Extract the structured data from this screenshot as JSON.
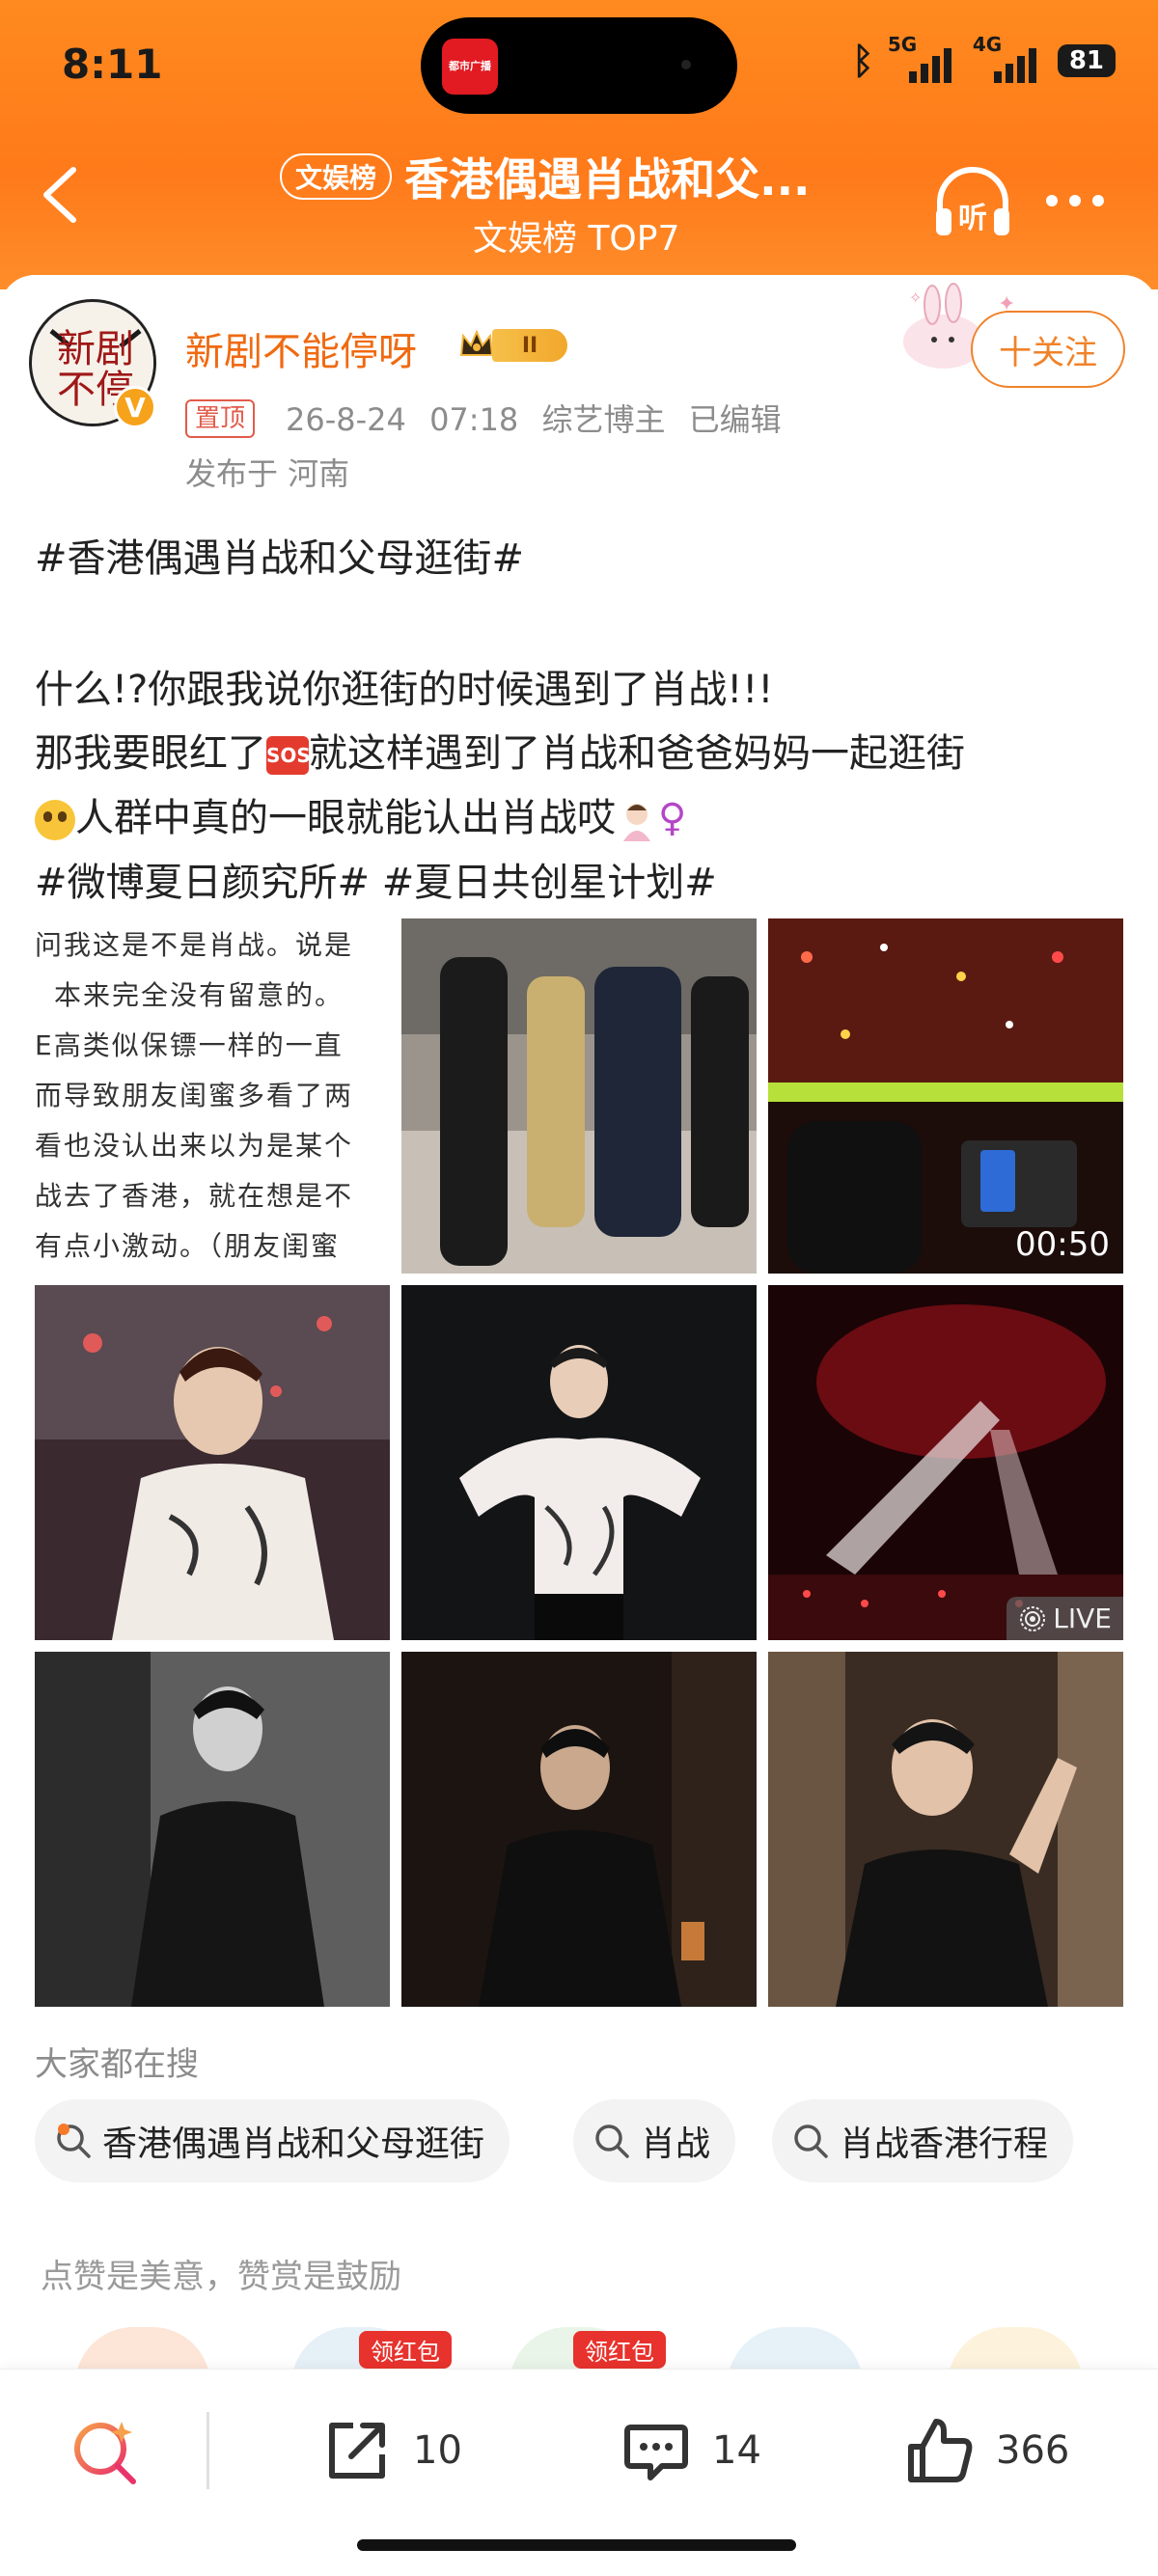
{
  "status_bar": {
    "time": "8:11",
    "island_app_label": "都市广播",
    "net_5g": "5G",
    "net_4g": "4G",
    "battery": "81"
  },
  "nav": {
    "tag": "文娱榜",
    "title": "香港偶遇肖战和父...",
    "subtitle": "文娱榜 TOP7",
    "headphone_label": "听"
  },
  "author": {
    "avatar_text": "新剧\n不停",
    "verified_mark": "V",
    "name": "新剧不能停呀",
    "rank": "II",
    "pin_label": "置顶",
    "meta": "26-8-24 07:18  综艺博主  已编辑",
    "location": "发布于 河南",
    "follow_label": "十关注"
  },
  "post": {
    "topic_title": "#香港偶遇肖战和父母逛街#",
    "line1": "什么!?你跟我说你逛街的时候遇到了肖战!!!",
    "line2_a": "那我要眼红了",
    "sos": "SOS",
    "line2_b": "就这样遇到了肖战和爸爸妈妈一起逛街",
    "line3": "人群中真的一眼就能认出肖战哎",
    "female_sign": "♀",
    "tags": "#微博夏日颜究所# #夏日共创星计划#"
  },
  "grid": {
    "text_image_lines": [
      "问我这是不是肖战。说是",
      "本来完全没有留意的。",
      "E高类似保镖一样的一直",
      "而导致朋友闺蜜多看了两",
      "看也没认出来以为是某个",
      "战去了香港，就在想是不",
      "有点小激动。（朋友闺蜜"
    ],
    "video_duration": "00:50",
    "live_label": "LIVE"
  },
  "search": {
    "heading": "大家都在搜",
    "chips": [
      "香港偶遇肖战和父母逛街",
      "肖战",
      "肖战香港行程"
    ]
  },
  "encourage": {
    "text": "点赞是美意，赞赏是鼓励",
    "hongbao_1": "领红包",
    "hongbao_2": "领红包"
  },
  "bottom_bar": {
    "share_count": "10",
    "comment_count": "14",
    "like_count": "366"
  },
  "colors": {
    "header_orange": "#ff7a1a",
    "hashtag_blue": "#476a9e",
    "username_orange": "#ef6a12",
    "follow_orange": "#f0822a"
  }
}
